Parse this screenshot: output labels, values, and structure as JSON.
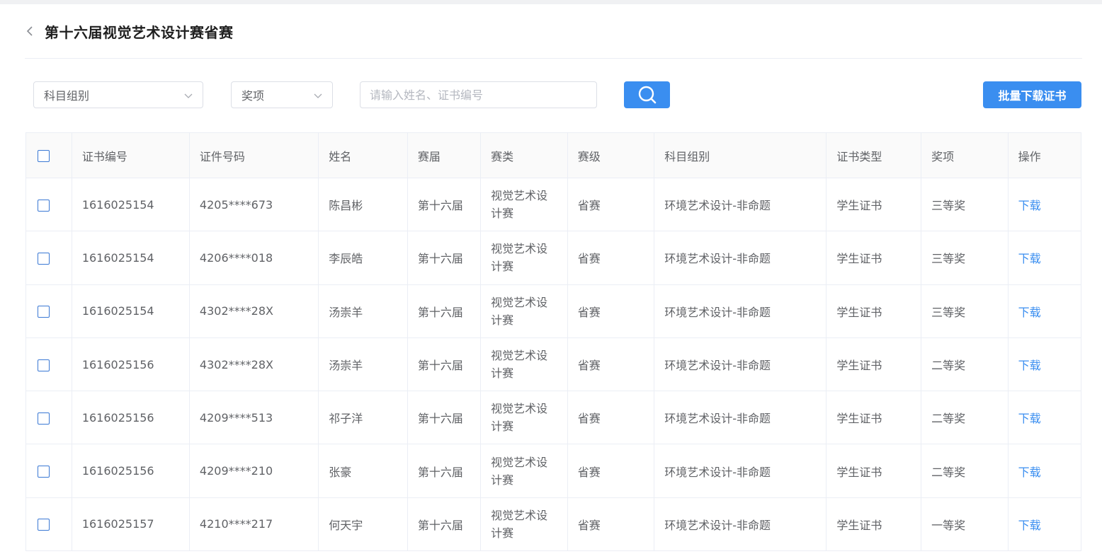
{
  "header": {
    "title": "第十六届视觉艺术设计赛省赛",
    "back_icon": "chevron-left-icon"
  },
  "filters": {
    "subject_group": {
      "value": "科目组别"
    },
    "award": {
      "value": "奖项"
    },
    "search": {
      "placeholder": "请输入姓名、证书编号"
    },
    "search_icon": "search-icon",
    "bulk_download_label": "批量下载证书"
  },
  "colors": {
    "primary": "#3a8ef0",
    "border": "#ebeef5"
  },
  "table": {
    "columns": [
      "证书编号",
      "证件号码",
      "姓名",
      "赛届",
      "赛类",
      "赛级",
      "科目组别",
      "证书类型",
      "奖项",
      "操作"
    ],
    "rows": [
      [
        "1616025154",
        "4205****673",
        "陈昌彬",
        "第十六届",
        "视觉艺术设计赛",
        "省赛",
        "环境艺术设计-非命题",
        "学生证书",
        "三等奖",
        "下载"
      ],
      [
        "1616025154",
        "4206****018",
        "李辰皓",
        "第十六届",
        "视觉艺术设计赛",
        "省赛",
        "环境艺术设计-非命题",
        "学生证书",
        "三等奖",
        "下载"
      ],
      [
        "1616025154",
        "4302****28X",
        "汤崇羊",
        "第十六届",
        "视觉艺术设计赛",
        "省赛",
        "环境艺术设计-非命题",
        "学生证书",
        "三等奖",
        "下载"
      ],
      [
        "1616025156",
        "4302****28X",
        "汤崇羊",
        "第十六届",
        "视觉艺术设计赛",
        "省赛",
        "环境艺术设计-非命题",
        "学生证书",
        "二等奖",
        "下载"
      ],
      [
        "1616025156",
        "4209****513",
        "祁子洋",
        "第十六届",
        "视觉艺术设计赛",
        "省赛",
        "环境艺术设计-非命题",
        "学生证书",
        "二等奖",
        "下载"
      ],
      [
        "1616025156",
        "4209****210",
        "张豪",
        "第十六届",
        "视觉艺术设计赛",
        "省赛",
        "环境艺术设计-非命题",
        "学生证书",
        "二等奖",
        "下载"
      ],
      [
        "1616025157",
        "4210****217",
        "何天宇",
        "第十六届",
        "视觉艺术设计赛",
        "省赛",
        "环境艺术设计-非命题",
        "学生证书",
        "一等奖",
        "下载"
      ]
    ]
  }
}
